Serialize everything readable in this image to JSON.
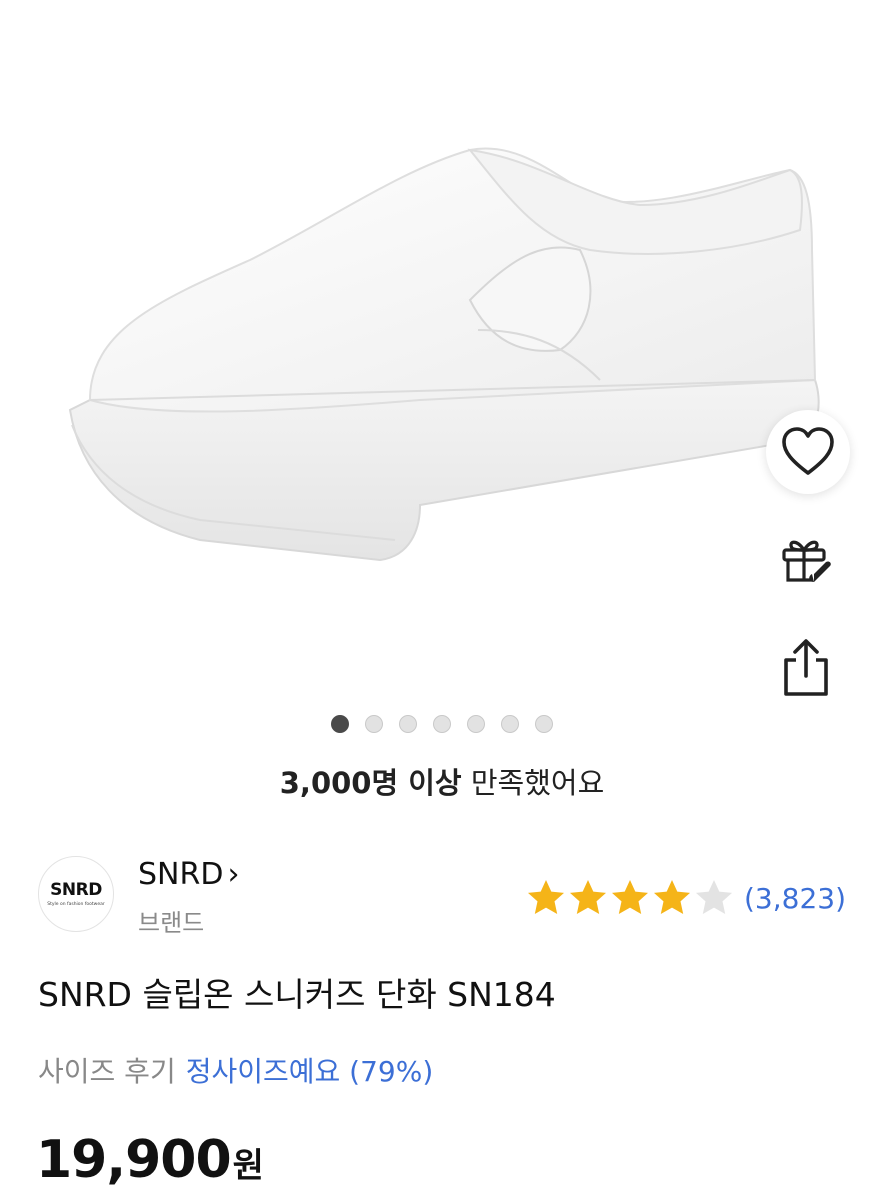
{
  "product": {
    "image_alt": "white slip-on sneaker",
    "carousel": {
      "total": 7,
      "active_index": 0
    },
    "satisfaction": {
      "bold": "3,000명 이상",
      "rest": "만족했어요"
    },
    "brand": {
      "logo_text": "SNRD",
      "logo_tagline": "Style on fashion footwear",
      "name": "SNRD",
      "chevron": "›",
      "subtitle": "브랜드"
    },
    "rating": {
      "value": 4,
      "max": 5,
      "count_text": "(3,823)",
      "star_color": "#f5b418",
      "empty_star_color": "#e3e3e3"
    },
    "title": "SNRD 슬립온 스니커즈 단화 SN184",
    "size_review": {
      "label": "사이즈 후기",
      "value": "정사이즈예요 (79%)"
    },
    "price": {
      "amount": "19,900",
      "unit": "원"
    }
  },
  "actions": {
    "wishlist_icon": "heart-icon",
    "gift_icon": "gift-icon",
    "share_icon": "share-icon"
  },
  "colors": {
    "accent_blue": "#3c6fd6",
    "text": "#111111",
    "muted": "#888888"
  }
}
